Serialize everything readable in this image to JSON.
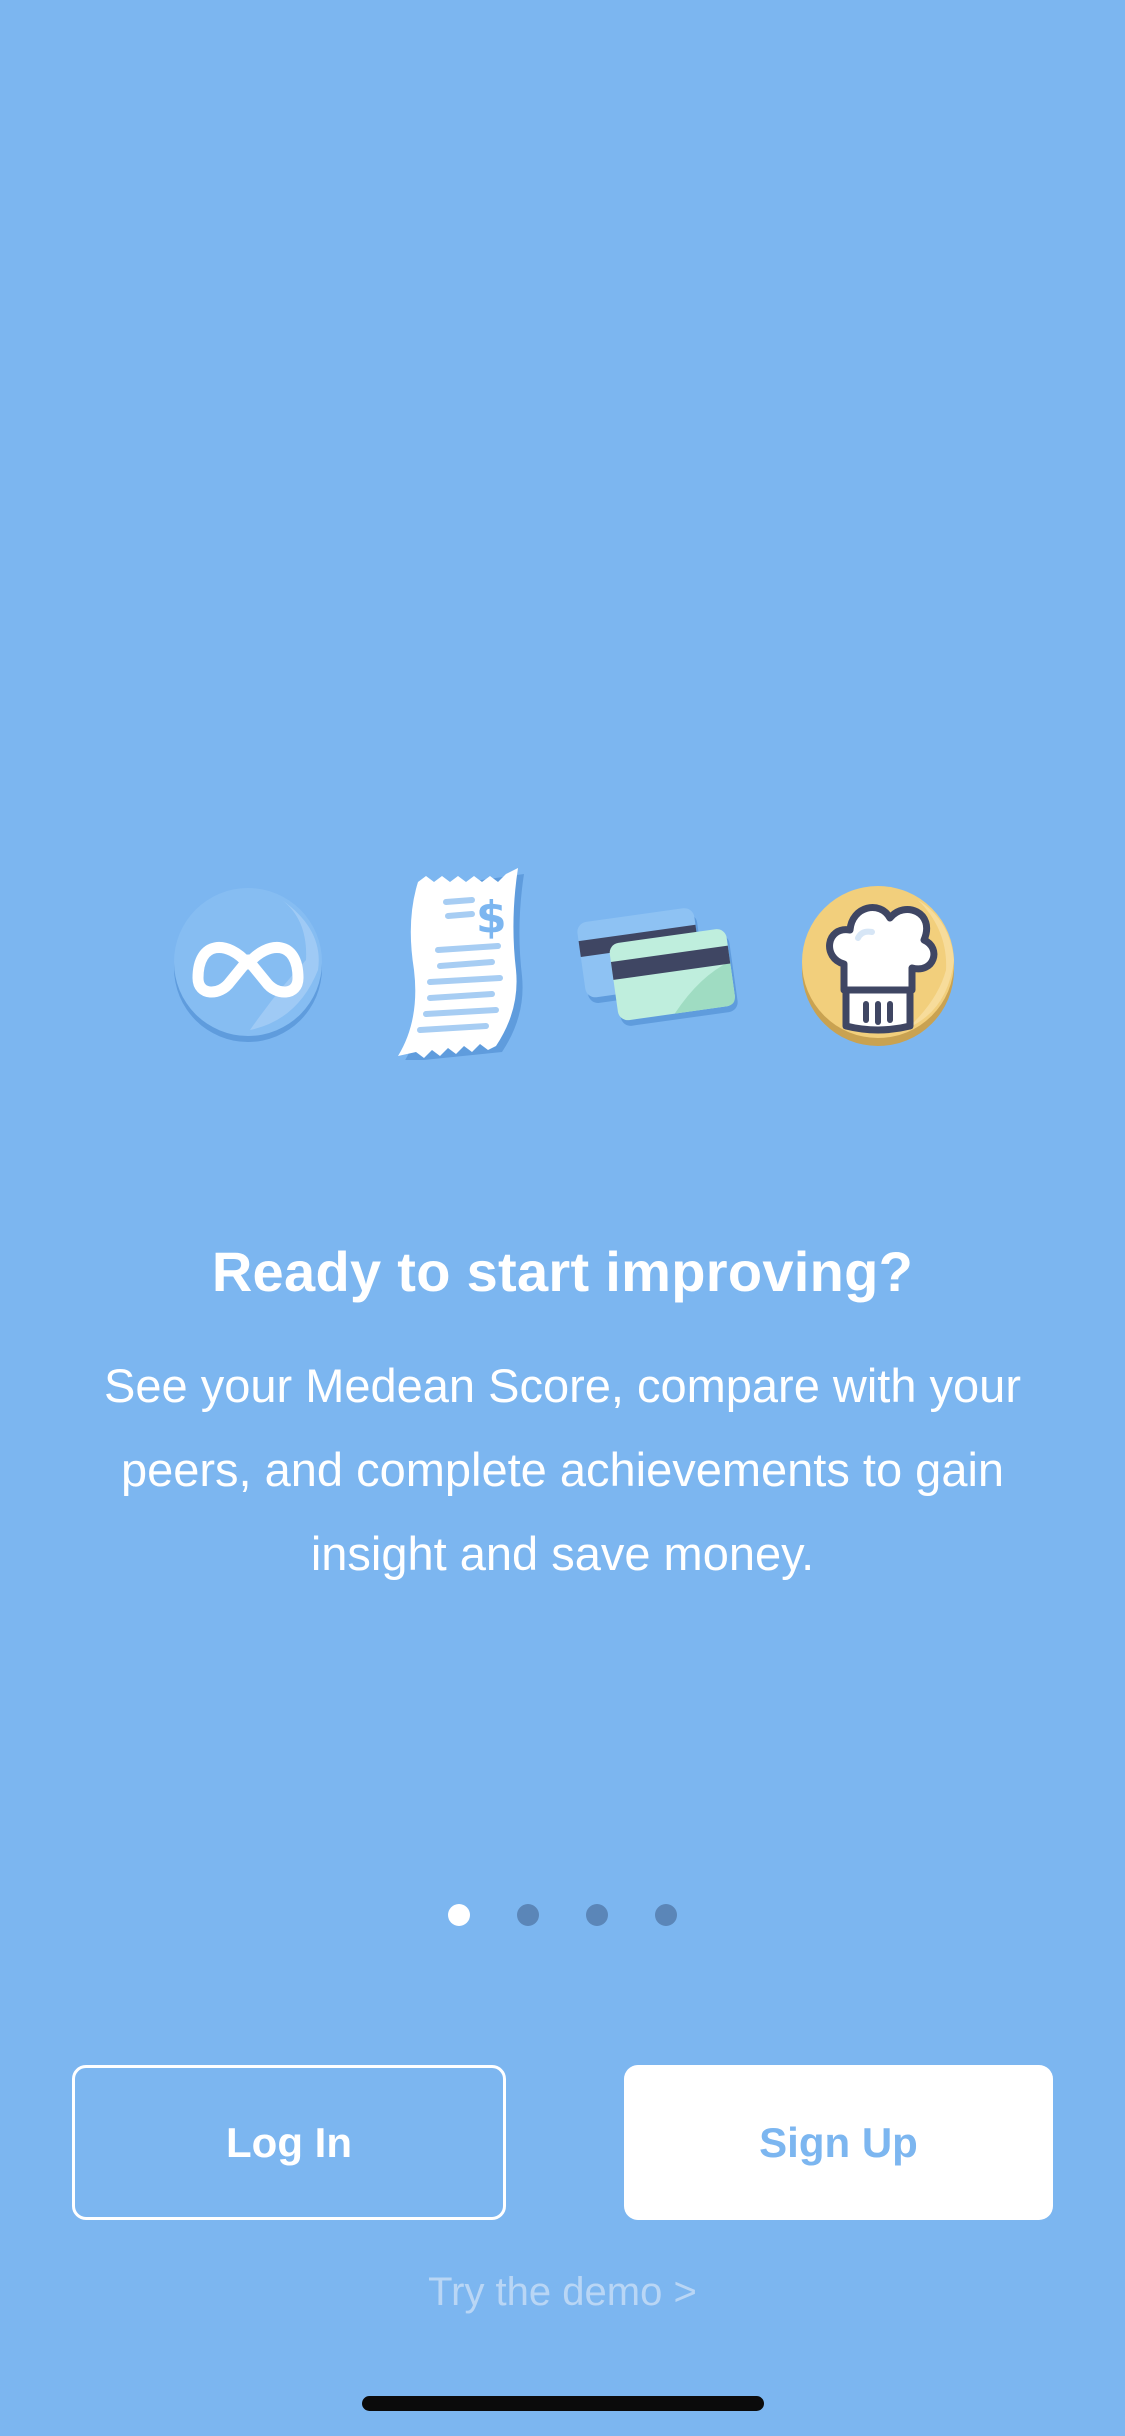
{
  "onboarding": {
    "icons": [
      {
        "name": "medean-logo-icon"
      },
      {
        "name": "receipt-icon"
      },
      {
        "name": "credit-cards-icon"
      },
      {
        "name": "chef-hat-icon"
      }
    ],
    "headline": "Ready to start improving?",
    "body": "See your Medean Score, compare with your peers, and complete achievements to gain insight and save money.",
    "pagination": {
      "total": 4,
      "current": 1
    }
  },
  "actions": {
    "login_label": "Log In",
    "signup_label": "Sign Up",
    "demo_label": "Try the demo >"
  },
  "colors": {
    "background": "#7cb6f0",
    "accent": "#ffffff",
    "dot_inactive": "#5b86b8"
  }
}
